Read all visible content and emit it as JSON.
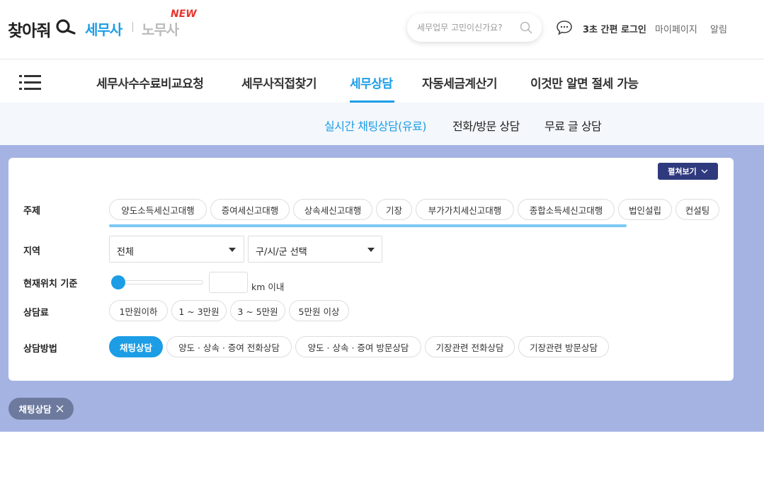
{
  "header": {
    "logo_main": "찾아줘",
    "logo_tax": "세무사",
    "logo_labor": "노무사",
    "logo_new": "NEW",
    "search_placeholder": "세무업무 고민이신가요?",
    "quick_login": "3초 간편 로그인",
    "mypage": "마이페이지",
    "alarm": "알림"
  },
  "gnb": {
    "items": [
      {
        "label": "세무사수수료비교요청"
      },
      {
        "label": "세무사직접찾기"
      },
      {
        "label": "세무상담",
        "active": true
      },
      {
        "label": "자동세금계산기"
      },
      {
        "label": "이것만 알면 절세 가능"
      }
    ]
  },
  "subnav": {
    "items": [
      {
        "label": "실시간 채팅상담(유료)",
        "active": true
      },
      {
        "label": "전화/방문 상담"
      },
      {
        "label": "무료 글 상담"
      }
    ]
  },
  "filter": {
    "expand_label": "펼쳐보기",
    "topic": {
      "label": "주제",
      "chips": [
        "양도소득세신고대행",
        "증여세신고대행",
        "상속세신고대행",
        "기장",
        "부가가치세신고대행",
        "종합소득세신고대행",
        "법인설립",
        "컨설팅"
      ]
    },
    "region": {
      "label": "지역",
      "city_value": "전체",
      "district_value": "구/시/군 선택"
    },
    "location": {
      "label": "현재위치 기준",
      "km_value": "",
      "unit": "km 이내",
      "slider_level": 0
    },
    "fee": {
      "label": "상담료",
      "chips": [
        "1만원이하",
        "1 ~ 3만원",
        "3 ~ 5만원",
        "5만원 이상"
      ]
    },
    "method": {
      "label": "상담방법",
      "chips": [
        "채팅상담",
        "양도 · 상속 · 증여 전화상담",
        "양도 · 상속 · 증여 방문상담",
        "기장관련 전화상담",
        "기장관련 방문상담"
      ],
      "selected": "채팅상담"
    }
  },
  "active_tags": [
    {
      "label": "채팅상담"
    }
  ],
  "colors": {
    "accent": "#1c9de6",
    "new_badge": "#e8342e",
    "filter_bg": "#a5b3e3",
    "expand_button": "#2f3a7e",
    "tag_bg": "#6d7a9e"
  }
}
